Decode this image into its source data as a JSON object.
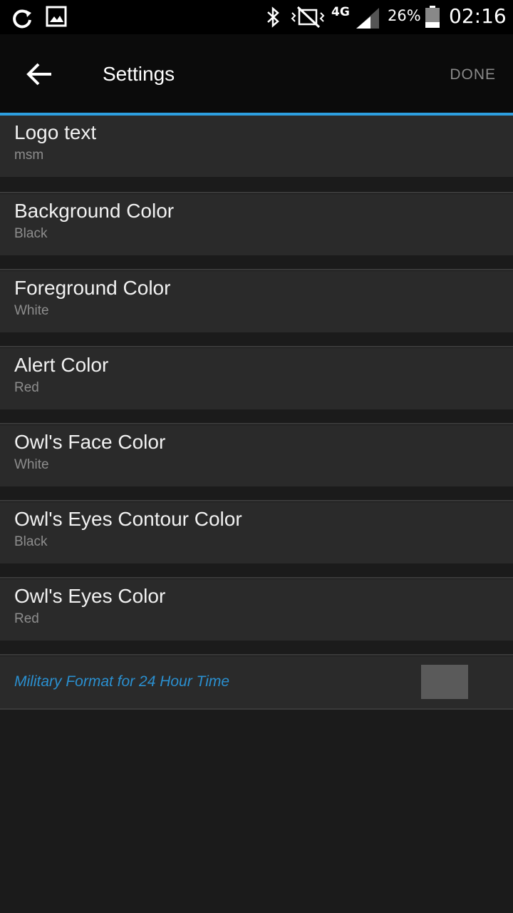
{
  "status_bar": {
    "battery_percent": "26%",
    "time": "02:16",
    "network": "4G",
    "icons": [
      "sync-icon",
      "image-icon",
      "bluetooth-icon",
      "vibrate-icon",
      "signal-icon",
      "battery-icon"
    ]
  },
  "header": {
    "title": "Settings",
    "done_label": "DONE",
    "back_icon": "arrow-left-icon"
  },
  "settings": {
    "items": [
      {
        "title": "Logo text",
        "value": "msm"
      },
      {
        "title": "Background Color",
        "value": "Black"
      },
      {
        "title": "Foreground Color",
        "value": "White"
      },
      {
        "title": "Alert Color",
        "value": "Red"
      },
      {
        "title": "Owl's Face Color",
        "value": "White"
      },
      {
        "title": "Owl's Eyes Contour Color",
        "value": "Black"
      },
      {
        "title": "Owl's Eyes Color",
        "value": "Red"
      }
    ],
    "military": {
      "label": "Military Format for 24 Hour Time",
      "checked": false
    }
  },
  "colors": {
    "accent": "#2d9fe0",
    "military_label": "#2a8fcf",
    "item_bg": "#2a2a2a",
    "page_bg": "#1b1b1b"
  }
}
